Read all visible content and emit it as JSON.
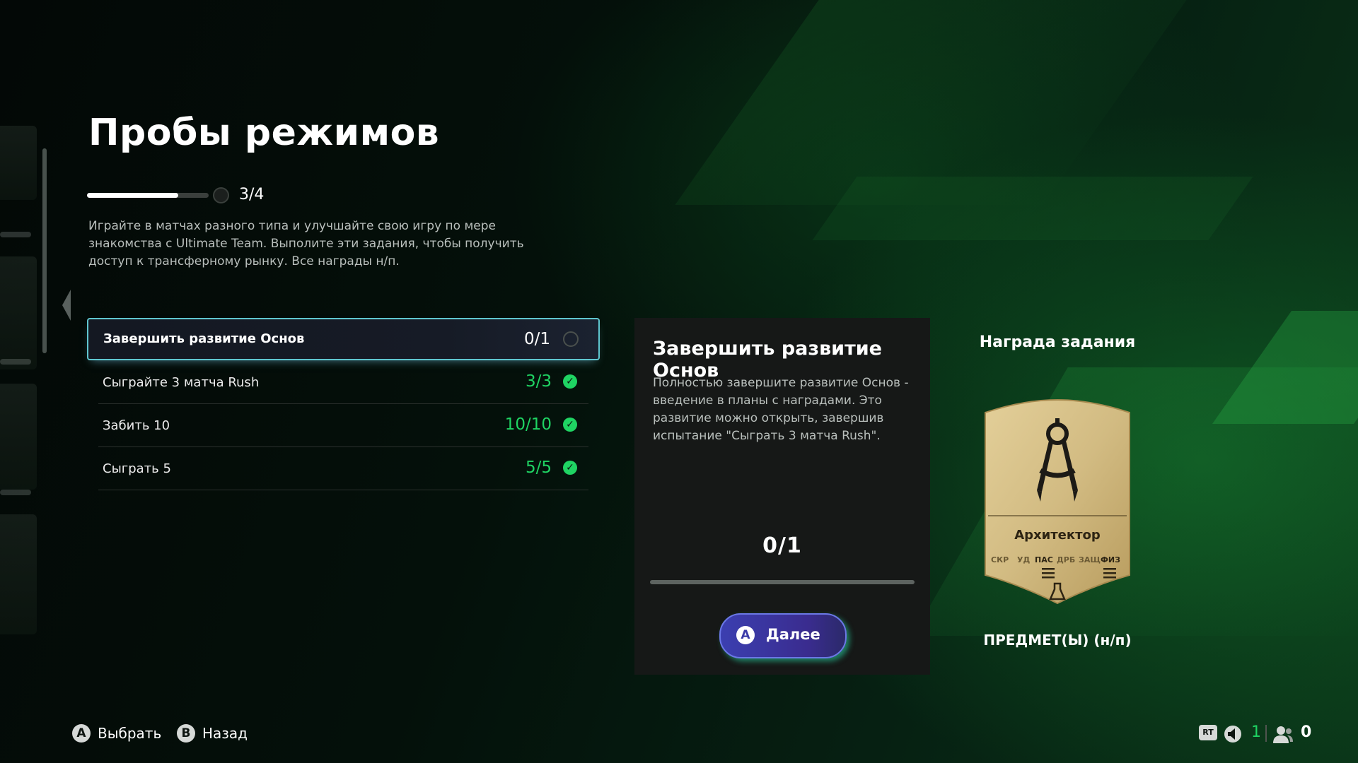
{
  "page": {
    "title": "Пробы режимов",
    "progress_text": "3/4",
    "progress_fraction": 0.75,
    "description": "Играйте в матчах разного типа и улучшайте свою игру по мере знакомства с Ultimate Team. Выполите эти задания, чтобы получить доступ к трансферному рынку. Все награды н/п."
  },
  "tasks": [
    {
      "label": "Завершить развитие Основ",
      "count": "0/1",
      "status": "pending",
      "selected": true
    },
    {
      "label": "Сыграйте 3 матча Rush",
      "count": "3/3",
      "status": "complete",
      "selected": false
    },
    {
      "label": "Забить 10",
      "count": "10/10",
      "status": "complete",
      "selected": false
    },
    {
      "label": "Сыграть 5",
      "count": "5/5",
      "status": "complete",
      "selected": false
    }
  ],
  "detail": {
    "title": "Завершить развитие Основ",
    "description": "Полностью завершите развитие Основ - введение в планы с наградами. Это развитие можно открыть, завершив испытание \"Сыграть 3 матча Rush\".",
    "count": "0/1",
    "progress_fraction": 0,
    "button_glyph": "A",
    "button_label": "Далее"
  },
  "reward": {
    "title": "Награда задания",
    "card_name": "Архитектор",
    "card_icon": "compass-icon",
    "stats": [
      "СКР",
      "УД",
      "ПАС",
      "ДРБ",
      "ЗАЩ",
      "ФИЗ"
    ],
    "highlighted_stats": [
      "ПАС",
      "ФИЗ"
    ],
    "caption": "ПРЕДМЕТ(Ы) (н/п)"
  },
  "footer": {
    "hints": [
      {
        "glyph": "A",
        "label": "Выбрать"
      },
      {
        "glyph": "B",
        "label": "Назад"
      }
    ],
    "rt_label": "RT",
    "online_count": "1",
    "friends_count": "0"
  },
  "colors": {
    "accent_green": "#1fd463",
    "selected_border": "#5fc6cf",
    "button_purple": "#3b3fb0",
    "card_gold": "#d8c38c"
  }
}
